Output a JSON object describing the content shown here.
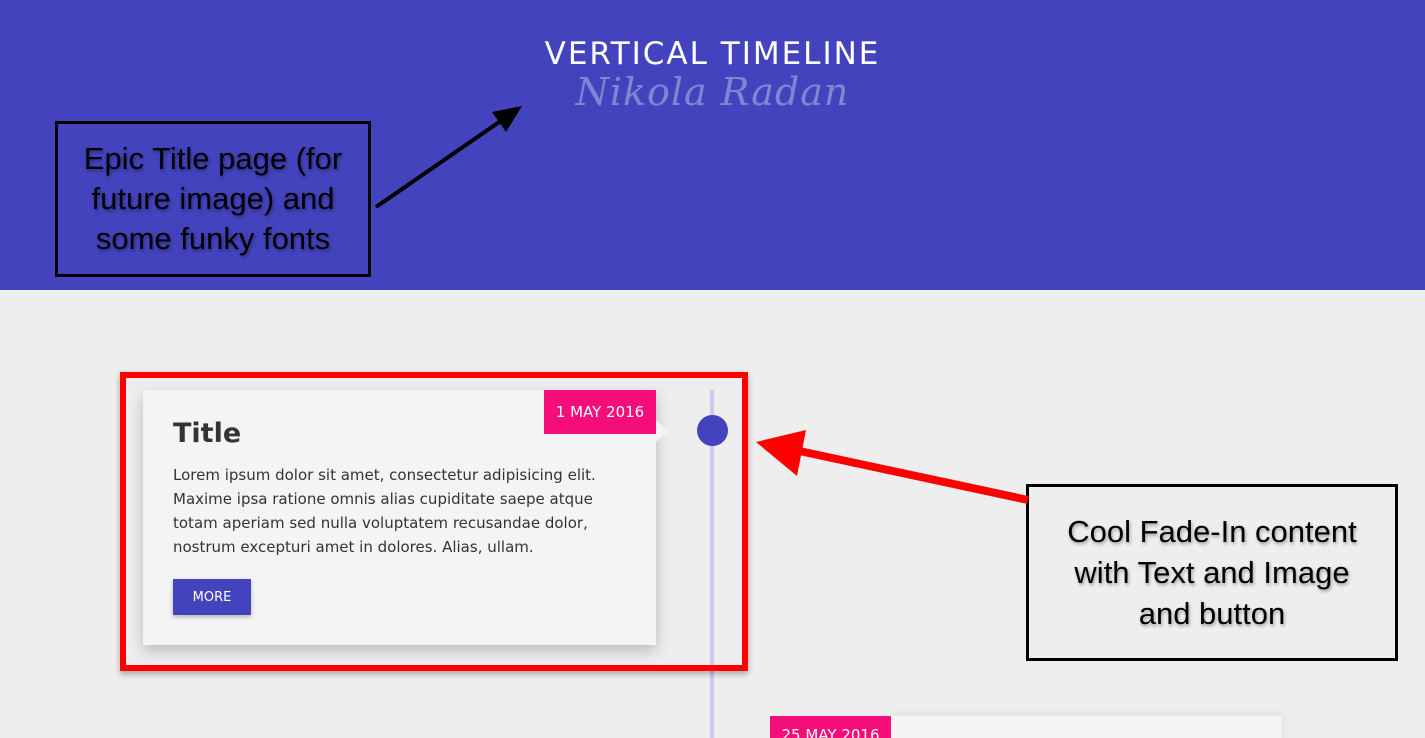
{
  "header": {
    "title": "VERTICAL TIMELINE",
    "subtitle": "Nikola Radan"
  },
  "annotations": {
    "title_note": "Epic Title page (for\nfuture image) and\nsome funky fonts",
    "fade_note": "Cool Fade-In content\nwith Text and Image\nand button"
  },
  "timeline": {
    "entries": [
      {
        "date": "1 MAY 2016",
        "title": "Title",
        "body": "Lorem ipsum dolor sit amet, consectetur adipisicing elit. Maxime ipsa ratione omnis alias cupiditate saepe atque totam aperiam sed nulla voluptatem recusandae dolor, nostrum excepturi amet in dolores. Alias, ullam.",
        "button": "MORE"
      },
      {
        "date": "25 MAY 2016"
      }
    ]
  },
  "colors": {
    "header_bg": "#4343bd",
    "accent": "#4343bd",
    "date_badge": "#f50e79",
    "highlight": "#ff0000",
    "page_bg": "#eeeeee"
  }
}
